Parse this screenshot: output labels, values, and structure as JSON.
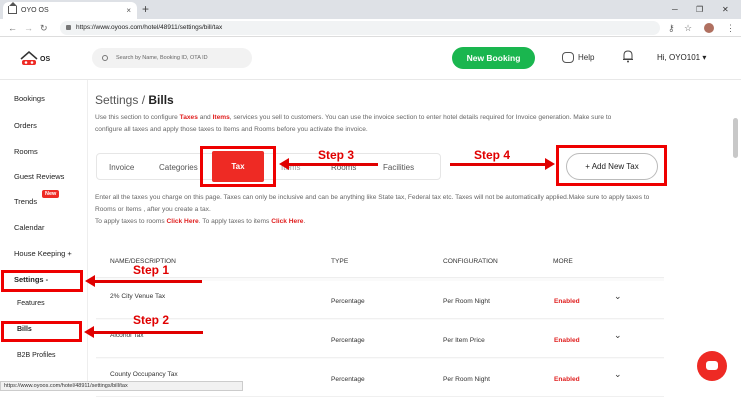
{
  "browser": {
    "tab_title": "OYO OS",
    "tab_close": "×",
    "new_tab": "+",
    "url": "https://www.oyoos.com/hotel/48911/settings/bill/tax",
    "status_url": "https://www.oyoos.com/hotel/48911/settings/bill/tax"
  },
  "header": {
    "logo_text": "OS",
    "search_placeholder": "Search by Name, Booking ID, OTA ID",
    "new_booking": "New Booking",
    "help": "Help",
    "user": "Hi, OYO101 ▾"
  },
  "sidebar": {
    "items": [
      {
        "label": "Bookings"
      },
      {
        "label": "Orders"
      },
      {
        "label": "Rooms"
      },
      {
        "label": "Guest Reviews"
      },
      {
        "label": "Trends",
        "badge": "New"
      },
      {
        "label": "Calendar"
      },
      {
        "label": "House Keeping  +"
      },
      {
        "label": "Settings   -"
      },
      {
        "label": "Features"
      },
      {
        "label": "Bills"
      },
      {
        "label": "B2B Profiles"
      }
    ]
  },
  "page": {
    "title_prefix": "Settings / ",
    "title_bold": "Bills",
    "intro_1": "Use this section to configure ",
    "intro_taxes": "Taxes",
    "intro_2": " and ",
    "intro_items": "Items",
    "intro_3": ", services you sell to customers. You can use the invoice section to enter hotel details required for Invoice generation. Make sure to configure all taxes and apply those taxes to Items and Rooms before you activate the invoice.",
    "tabs": [
      "Invoice",
      "Categories",
      "Tax",
      "Items",
      "Rooms",
      "Facilities"
    ],
    "add_tax": "+  Add New Tax",
    "desc_1": "Enter all the taxes you charge on this page. Taxes can only be inclusive and can be anything like State tax, Federal tax etc. Taxes will not be automatically applied.Make sure to apply taxes to Rooms or Items , after you create a tax.",
    "desc_2a": "To apply taxes to rooms ",
    "desc_click1": "Click Here",
    "desc_2b": ". To apply taxes to items ",
    "desc_click2": "Click Here",
    "desc_2c": "."
  },
  "table": {
    "headers": [
      "NAME/DESCRIPTION",
      "TYPE",
      "CONFIGURATION",
      "MORE"
    ],
    "rows": [
      {
        "name": "2% City Venue Tax",
        "type": "Percentage",
        "config": "Per Room Night",
        "status": "Enabled"
      },
      {
        "name": "Alcohol Tax",
        "type": "Percentage",
        "config": "Per Item Price",
        "status": "Enabled"
      },
      {
        "name": "County Occupancy Tax",
        "type": "Percentage",
        "config": "Per Room Night",
        "status": "Enabled"
      }
    ]
  },
  "annotations": {
    "step1": "Step 1",
    "step2": "Step 2",
    "step3": "Step 3",
    "step4": "Step 4"
  },
  "colors": {
    "brand_red": "#ee2a24",
    "new_booking_green": "#1ab64f",
    "annotation_red": "#e00000"
  }
}
